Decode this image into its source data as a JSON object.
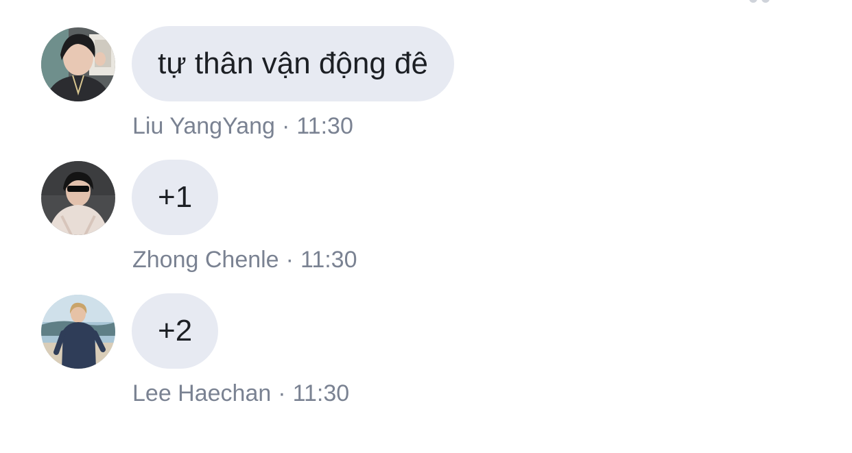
{
  "colors": {
    "bubble_background": "#e7eaf2",
    "message_text": "#1c1f24",
    "meta_text": "#7a8292",
    "page_background": "#ffffff"
  },
  "messages": [
    {
      "text": "tự thân vận động đê",
      "sender": "Liu YangYang",
      "separator": "·",
      "time": "11:30"
    },
    {
      "text": "+1",
      "sender": "Zhong Chenle",
      "separator": "·",
      "time": "11:30"
    },
    {
      "text": "+2",
      "sender": "Lee Haechan",
      "separator": "·",
      "time": "11:30"
    }
  ]
}
